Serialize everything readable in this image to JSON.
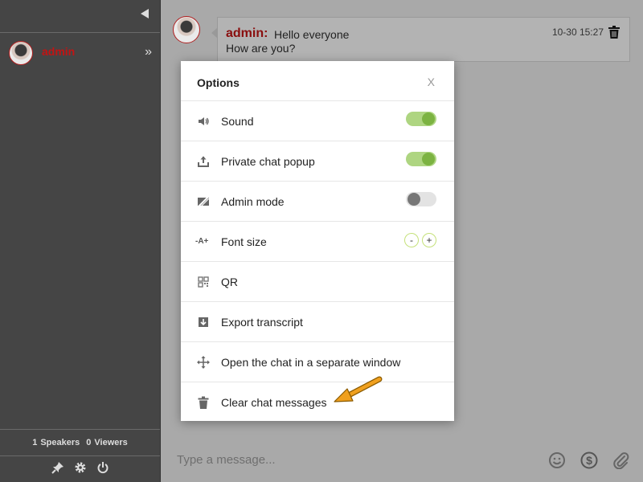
{
  "sidebar": {
    "user_name": "admin",
    "speakers_count": "1",
    "speakers_label": "Speakers",
    "viewers_count": "0",
    "viewers_label": "Viewers"
  },
  "message": {
    "author": "admin:",
    "line1": "Hello everyone",
    "line2": "How are you?",
    "time": "10-30 15:27"
  },
  "composer": {
    "placeholder": "Type a message..."
  },
  "options": {
    "title": "Options",
    "close": "X",
    "items": [
      {
        "label": "Sound",
        "icon": "speaker-icon",
        "toggle": "on"
      },
      {
        "label": "Private chat popup",
        "icon": "upload-icon",
        "toggle": "on"
      },
      {
        "label": "Admin mode",
        "icon": "slash-icon",
        "toggle": "off"
      },
      {
        "label": "Font size",
        "icon": "font-size-icon",
        "minus": "-",
        "plus": "+",
        "icon_text": "-A+"
      },
      {
        "label": "QR",
        "icon": "qr-icon"
      },
      {
        "label": "Export transcript",
        "icon": "download-icon"
      },
      {
        "label": "Open the chat in a separate window",
        "icon": "move-icon"
      },
      {
        "label": "Clear chat messages",
        "icon": "trash-icon"
      }
    ]
  },
  "colors": {
    "accent_green": "#7cb342",
    "admin_red": "#c21414",
    "sidebar_bg": "#454545",
    "arrow_orange": "#f0a01e"
  }
}
